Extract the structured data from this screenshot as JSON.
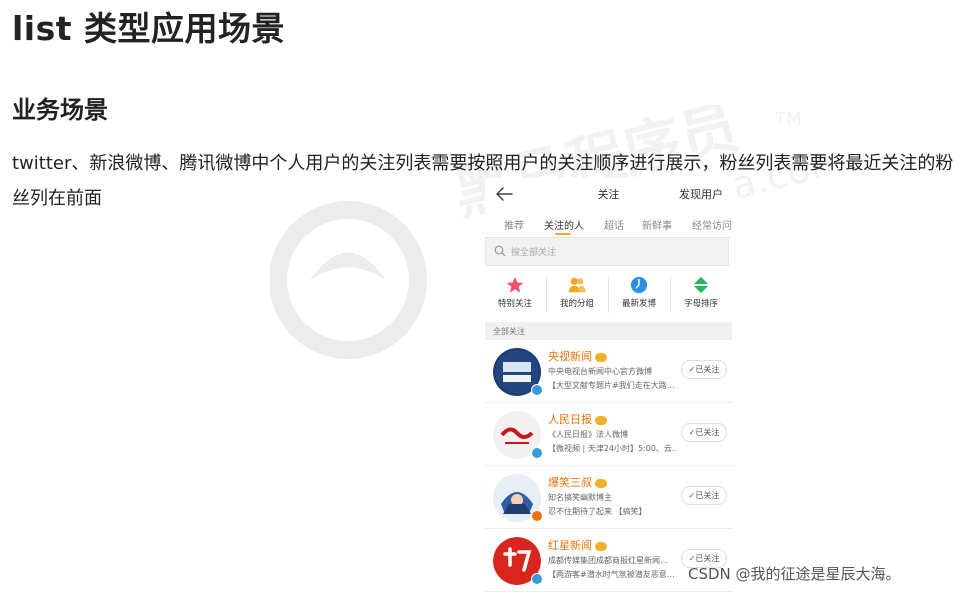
{
  "document": {
    "title": "list 类型应用场景",
    "section_heading": "业务场景",
    "paragraph": "twitter、新浪微博、腾讯微博中个人用户的关注列表需要按照用户的关注顺序进行展示，粉丝列表需要将最近关注的粉丝列在前面"
  },
  "phone": {
    "nav": {
      "title": "关注",
      "right": "发现用户",
      "back_icon": "arrow-left-icon"
    },
    "tabs": [
      {
        "label": "推荐",
        "active": false
      },
      {
        "label": "关注的人",
        "active": true
      },
      {
        "label": "超话",
        "active": false
      },
      {
        "label": "新鲜事",
        "active": false
      },
      {
        "label": "经常访问",
        "active": false
      }
    ],
    "search": {
      "placeholder": "搜全部关注"
    },
    "shortcuts": [
      {
        "label": "特别关注",
        "icon": "star-icon",
        "color": "#f0506e"
      },
      {
        "label": "我的分组",
        "icon": "group-icon",
        "color": "#f5a623"
      },
      {
        "label": "最新发博",
        "icon": "clock-icon",
        "color": "#2f8fe0"
      },
      {
        "label": "字母排序",
        "icon": "sort-icon",
        "color": "#2db35d"
      }
    ],
    "section_label": "全部关注",
    "users": [
      {
        "name": "央视新闻",
        "desc": "中央电视台新闻中心官方微博",
        "post": "【大型文献专题片#我们走在大路…",
        "button": "✓已关注"
      },
      {
        "name": "人民日报",
        "desc": "《人民日报》法人微博",
        "post": "【微视频 | 天津24小时】5:00、云…",
        "button": "✓已关注"
      },
      {
        "name": "爆笑三叔",
        "desc": "知名搞笑幽默博主",
        "post": "忍不住期待了起来 【搞笑】",
        "button": "✓已关注"
      },
      {
        "name": "红星新闻",
        "desc": "成都传媒集团成都商报红星新闻…",
        "post": "【两游客#潜水时气氛被潜友恶意…",
        "button": "✓已关注"
      }
    ]
  },
  "watermark": {
    "brand": "黑马程序员",
    "url": "www.itheima.com",
    "tm": "TM"
  },
  "footer": {
    "csdn": "CSDN @我的征途是星辰大海。"
  }
}
